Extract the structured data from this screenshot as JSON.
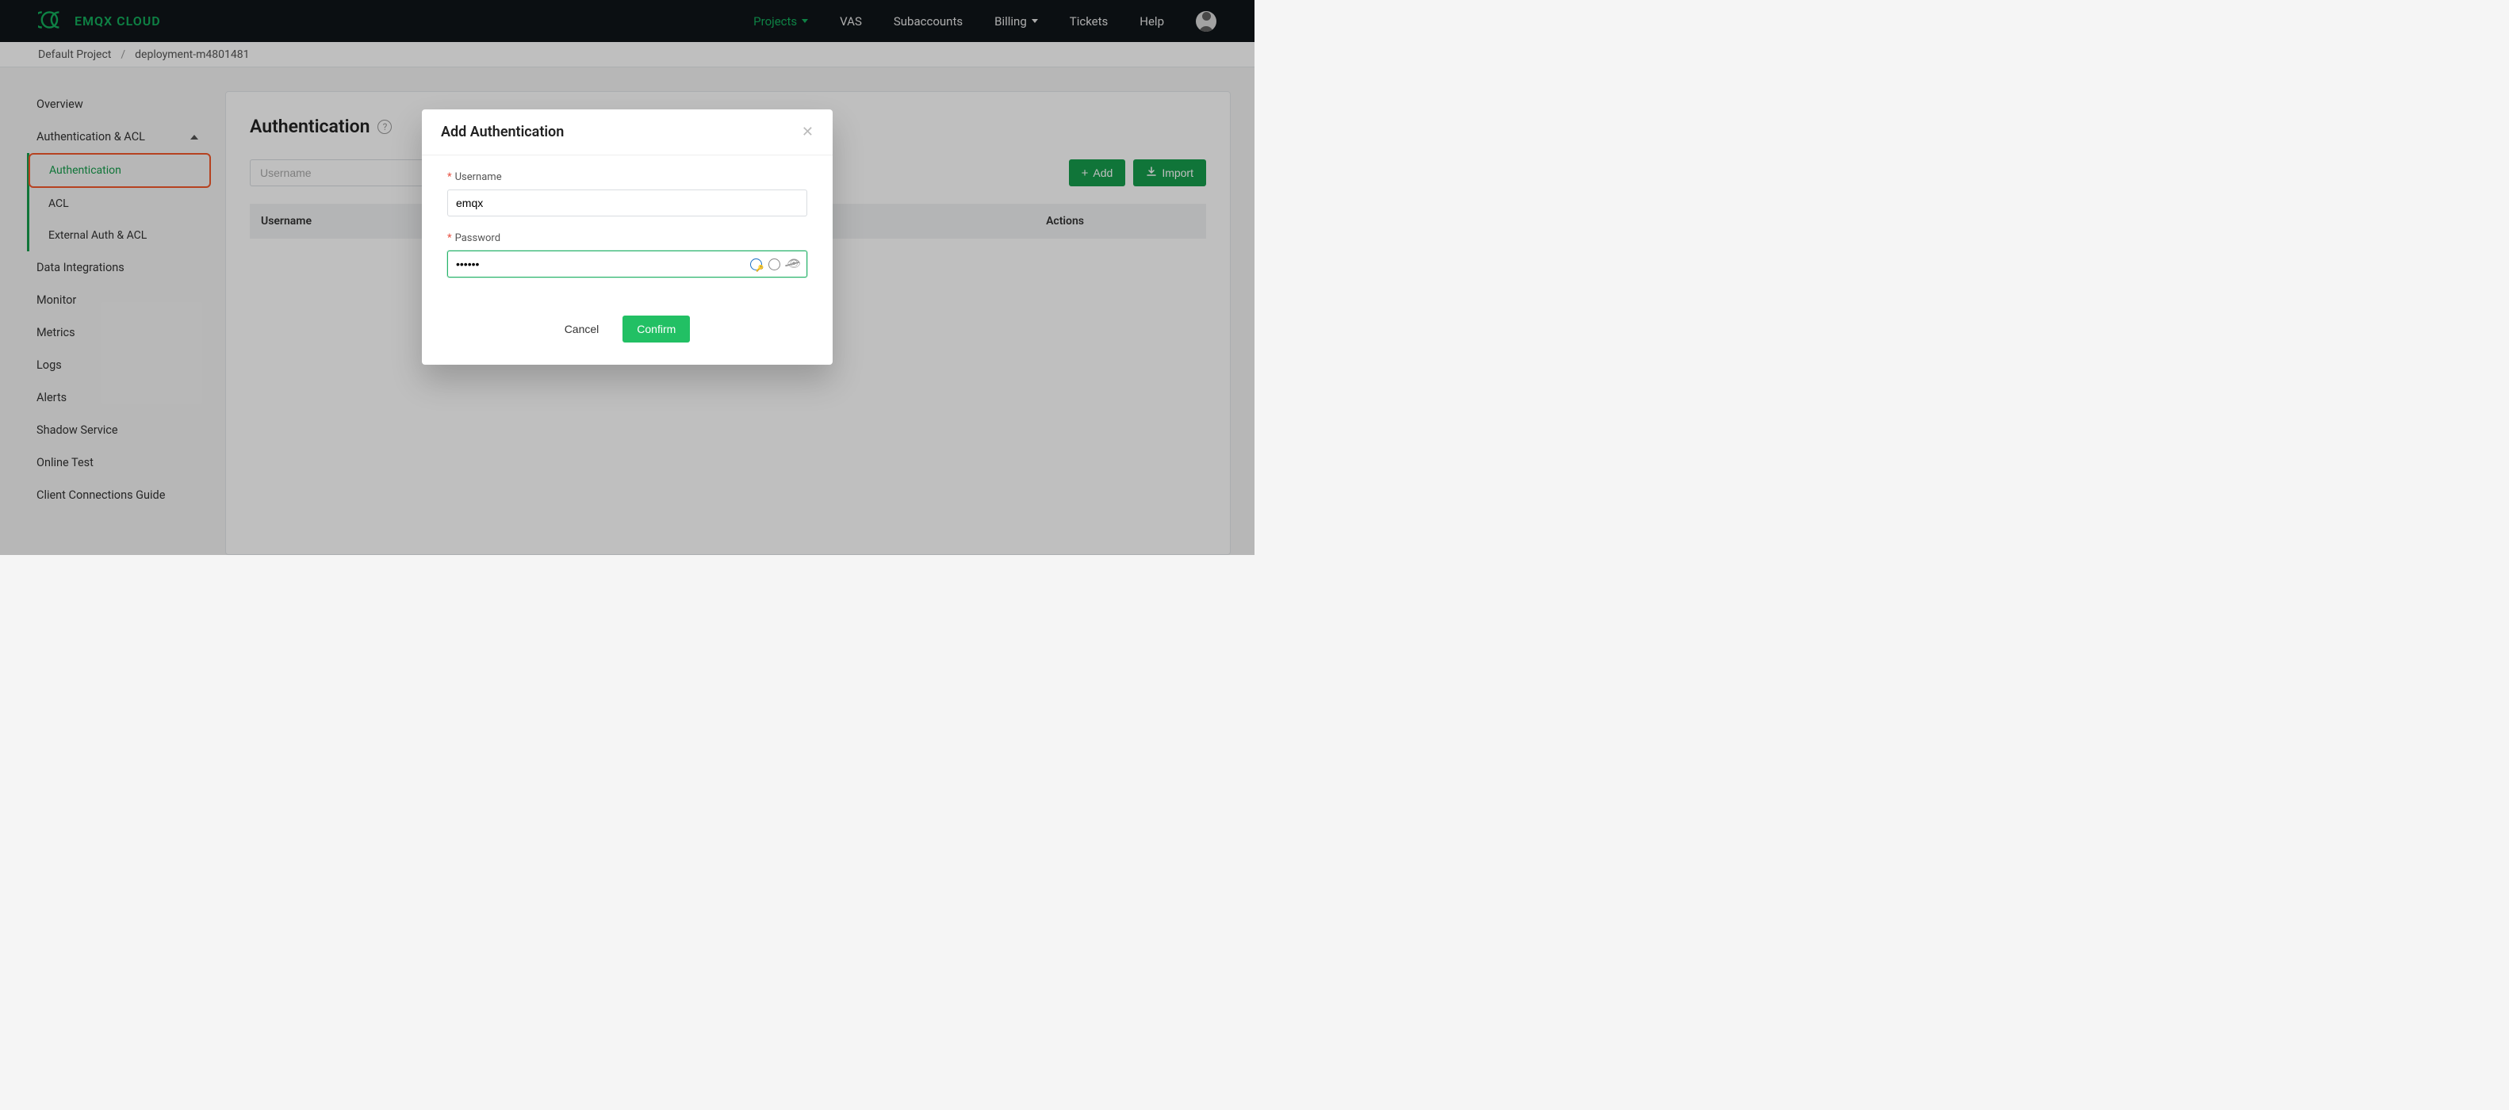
{
  "brand": "EMQX CLOUD",
  "nav": {
    "projects": "Projects",
    "vas": "VAS",
    "subaccounts": "Subaccounts",
    "billing": "Billing",
    "tickets": "Tickets",
    "help": "Help"
  },
  "breadcrumb": {
    "root": "Default Project",
    "current": "deployment-m4801481"
  },
  "sidebar": {
    "overview": "Overview",
    "auth_acl": "Authentication & ACL",
    "auth": "Authentication",
    "acl": "ACL",
    "external": "External Auth & ACL",
    "data_integrations": "Data Integrations",
    "monitor": "Monitor",
    "metrics": "Metrics",
    "logs": "Logs",
    "alerts": "Alerts",
    "shadow": "Shadow Service",
    "online_test": "Online Test",
    "cc_guide": "Client Connections Guide"
  },
  "page": {
    "title": "Authentication",
    "search_placeholder": "Username",
    "add_btn": "Add",
    "import_btn": "Import",
    "col_username": "Username",
    "col_actions": "Actions"
  },
  "modal": {
    "title": "Add Authentication",
    "username_label": "Username",
    "username_value": "emqx",
    "password_label": "Password",
    "password_value": "••••••",
    "cancel": "Cancel",
    "confirm": "Confirm"
  }
}
